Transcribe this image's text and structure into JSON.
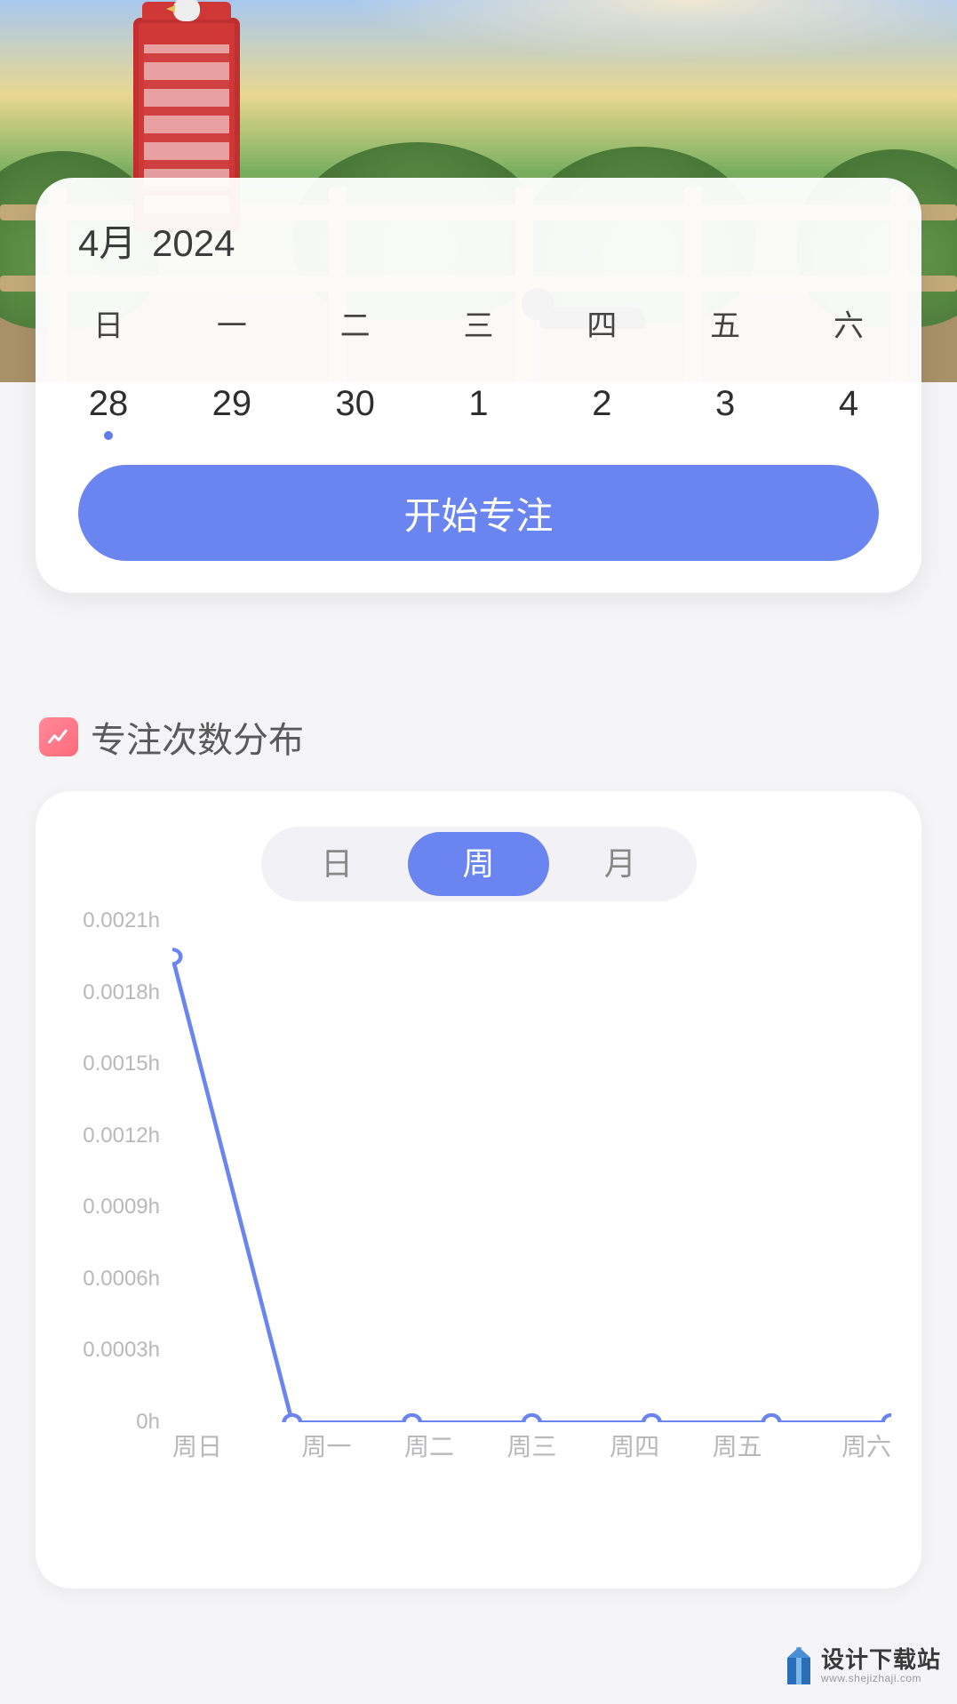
{
  "calendar": {
    "month_label": "4月",
    "year": "2024",
    "weekdays": [
      "日",
      "一",
      "二",
      "三",
      "四",
      "五",
      "六"
    ],
    "days": [
      {
        "num": "28",
        "selected": true
      },
      {
        "num": "29",
        "selected": false
      },
      {
        "num": "30",
        "selected": false
      },
      {
        "num": "1",
        "selected": false
      },
      {
        "num": "2",
        "selected": false
      },
      {
        "num": "3",
        "selected": false
      },
      {
        "num": "4",
        "selected": false
      }
    ],
    "start_button": "开始专注"
  },
  "section": {
    "title": "专注次数分布"
  },
  "segments": {
    "options": [
      {
        "label": "日",
        "active": false
      },
      {
        "label": "周",
        "active": true
      },
      {
        "label": "月",
        "active": false
      }
    ]
  },
  "chart_data": {
    "type": "line",
    "title": "专注次数分布",
    "xlabel": "",
    "ylabel": "",
    "y_unit": "h",
    "ylim": [
      0,
      0.0021
    ],
    "y_ticks": [
      "0.0021h",
      "0.0018h",
      "0.0015h",
      "0.0012h",
      "0.0009h",
      "0.0006h",
      "0.0003h",
      "0h"
    ],
    "categories": [
      "周日",
      "周一",
      "周二",
      "周三",
      "周四",
      "周五",
      "周六"
    ],
    "values": [
      0.00195,
      0,
      0,
      0,
      0,
      0,
      0
    ],
    "series_color": "#6a85ef"
  },
  "watermark": {
    "brand": "设计下载站",
    "url": "www.shejizhaji.com"
  }
}
